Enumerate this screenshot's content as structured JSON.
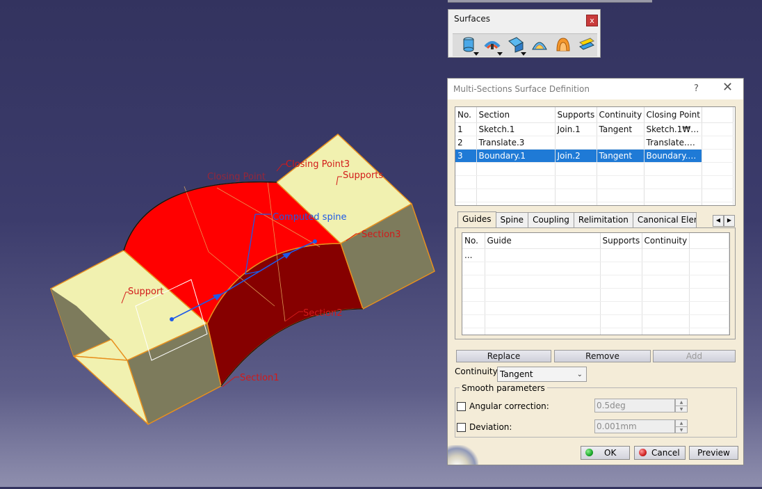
{
  "viewport": {
    "labels": {
      "closing_point3": "Closing Point3",
      "closing_point": "Closing Point",
      "supports_top": "Supports",
      "computed_spine": "Computed spine",
      "section3": "Section3",
      "section2": "Section2",
      "section1": "Section1",
      "support_left": "Support"
    },
    "colors": {
      "shape_orange": "#e8901e",
      "face_cream": "#f1f1b0",
      "face_red": "#ff0000",
      "face_darkred": "#860000",
      "face_olive": "#7d7b5c",
      "label_red": "#d21a1a",
      "spine_blue": "#1e5ae8"
    }
  },
  "toolbar": {
    "title": "Surfaces",
    "close_label": "x",
    "icons": [
      "extrude-surface-icon",
      "offset-surface-icon",
      "sweep-surface-icon",
      "fill-surface-icon",
      "multi-sections-surface-icon",
      "blend-surface-icon"
    ]
  },
  "dialog": {
    "title": "Multi-Sections Surface Definition",
    "help_label": "?",
    "close_label": "✕",
    "sections_table": {
      "headers": [
        "No.",
        "Section",
        "Supports",
        "Continuity",
        "Closing Point"
      ],
      "rows": [
        {
          "no": "1",
          "section": "Sketch.1",
          "supports": "Join.1",
          "continuity": "Tangent",
          "closing": "Sketch.1₩Ve..."
        },
        {
          "no": "2",
          "section": "Translate.3",
          "supports": "",
          "continuity": "",
          "closing": "Translate.3₩..."
        },
        {
          "no": "3",
          "section": "Boundary.1",
          "supports": "Join.2",
          "continuity": "Tangent",
          "closing": "Boundary.1₩..."
        }
      ],
      "selected_row": 3
    },
    "tabs": [
      "Guides",
      "Spine",
      "Coupling",
      "Relimitation",
      "Canonical Eleme"
    ],
    "active_tab": "Guides",
    "tab_scroll": {
      "left": "◀",
      "right": "▶"
    },
    "guides_table": {
      "headers": [
        "No.",
        "Guide",
        "Supports",
        "Continuity"
      ],
      "rows": [
        {
          "no": "...",
          "guide": "",
          "supports": "",
          "continuity": ""
        }
      ]
    },
    "buttons": {
      "replace": "Replace",
      "remove": "Remove",
      "add": "Add"
    },
    "continuity": {
      "label": "Continuity:",
      "value": "Tangent",
      "chevron": "⌄"
    },
    "smooth": {
      "legend": "Smooth parameters",
      "angular_label": "Angular correction:",
      "angular_value": "0.5deg",
      "angular_checked": false,
      "deviation_label": "Deviation:",
      "deviation_value": "0.001mm",
      "deviation_checked": false
    },
    "footer": {
      "ok": "OK",
      "cancel": "Cancel",
      "preview": "Preview"
    },
    "colors": {
      "ok_dot": "#1aa82a",
      "cancel_dot": "#d12424",
      "selection": "#1f7ad6",
      "panel_bg": "#f4ecd8"
    }
  }
}
